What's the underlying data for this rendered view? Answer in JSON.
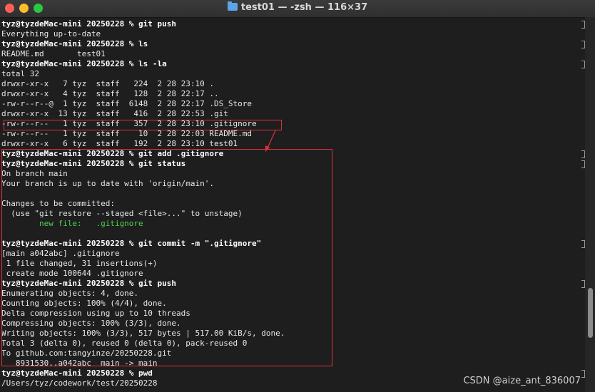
{
  "window": {
    "title": "test01 — -zsh — 116×37",
    "folder_icon": "folder-icon"
  },
  "terminal": {
    "lines": [
      "tyz@tyzdeMac-mini 20250228 % git push",
      "Everything up-to-date",
      "tyz@tyzdeMac-mini 20250228 % ls",
      "README.md       test01",
      "tyz@tyzdeMac-mini 20250228 % ls -la",
      "total 32",
      "drwxr-xr-x   7 tyz  staff   224  2 28 23:10 .",
      "drwxr-xr-x   4 tyz  staff   128  2 28 22:17 ..",
      "-rw-r--r--@  1 tyz  staff  6148  2 28 22:17 .DS_Store",
      "drwxr-xr-x  13 tyz  staff   416  2 28 22:53 .git",
      "-rw-r--r--   1 tyz  staff   357  2 28 23:10 .gitignore",
      "-rw-r--r--   1 tyz  staff    10  2 28 22:03 README.md",
      "drwxr-xr-x   6 tyz  staff   192  2 28 23:10 test01",
      "tyz@tyzdeMac-mini 20250228 % git add .gitignore",
      "tyz@tyzdeMac-mini 20250228 % git status",
      "On branch main",
      "Your branch is up to date with 'origin/main'.",
      "",
      "Changes to be committed:",
      "  (use \"git restore --staged <file>...\" to unstage)",
      "        new file:   .gitignore",
      "",
      "tyz@tyzdeMac-mini 20250228 % git commit -m \".gitignore\"",
      "[main a042abc] .gitignore",
      " 1 file changed, 31 insertions(+)",
      " create mode 100644 .gitignore",
      "tyz@tyzdeMac-mini 20250228 % git push",
      "Enumerating objects: 4, done.",
      "Counting objects: 100% (4/4), done.",
      "Delta compression using up to 10 threads",
      "Compressing objects: 100% (3/3), done.",
      "Writing objects: 100% (3/3), 517 bytes | 517.00 KiB/s, done.",
      "Total 3 (delta 0), reused 0 (delta 0), pack-reused 0",
      "To github.com:tangyinze/20250228.git",
      "   8931530..a042abc  main -> main",
      "tyz@tyzdeMac-mini 20250228 % pwd",
      "/Users/tyz/codework/test/20250228"
    ],
    "prompt_line_indexes": [
      0,
      2,
      4,
      13,
      14,
      22,
      26,
      35
    ],
    "green_line_indexes": [
      20
    ],
    "green_color": "#4fd04f",
    "annotation_color": "#e0303a"
  },
  "scrollbar": {
    "position_fraction": 0.82
  },
  "watermark": "CSDN @aize_ant_836007"
}
